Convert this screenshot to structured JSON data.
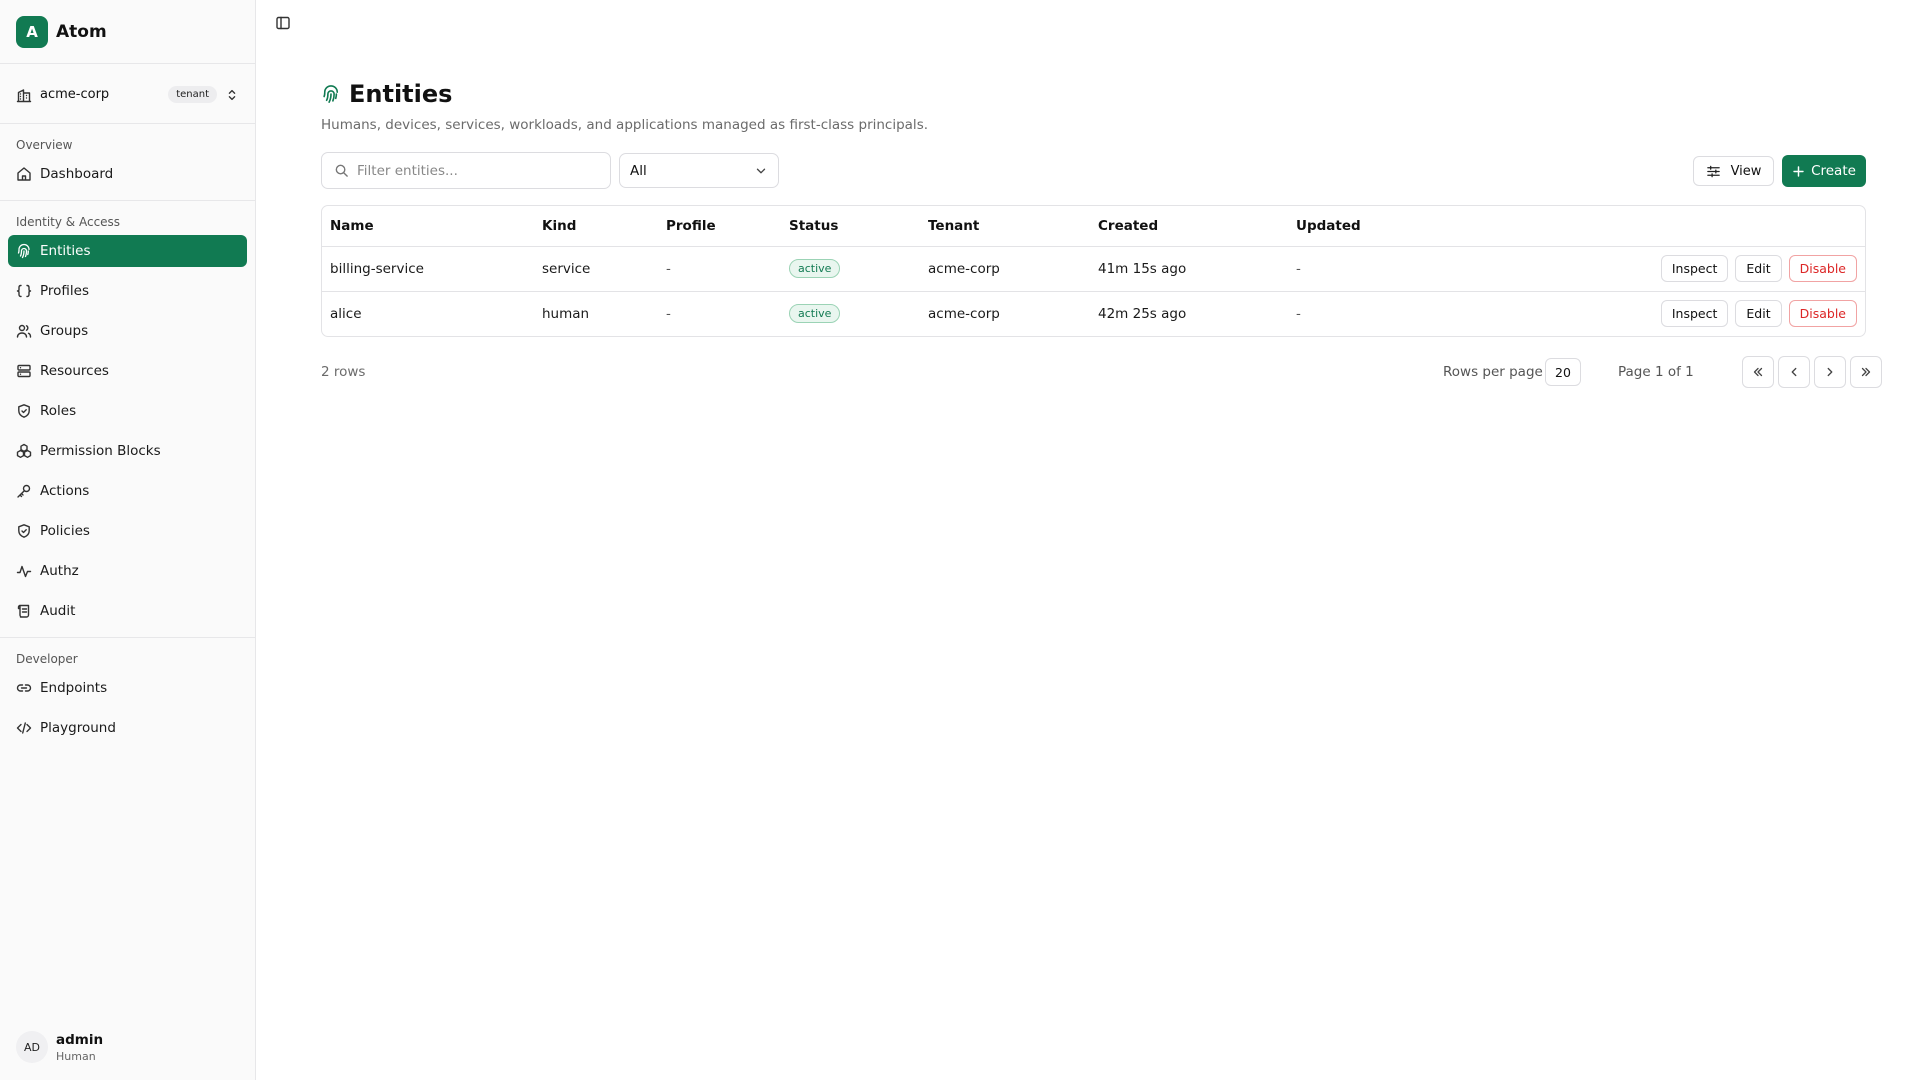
{
  "brand": {
    "logo_letter": "A",
    "name": "Atom",
    "accent": "#117a52"
  },
  "tenant": {
    "name": "acme-corp",
    "badge": "tenant"
  },
  "sidebar": {
    "sections": [
      {
        "title": "Overview",
        "items": [
          {
            "label": "Dashboard",
            "icon": "home-icon"
          }
        ]
      },
      {
        "title": "Identity & Access",
        "items": [
          {
            "label": "Entities",
            "icon": "fingerprint-icon",
            "active": true
          },
          {
            "label": "Profiles",
            "icon": "braces-icon"
          },
          {
            "label": "Groups",
            "icon": "users-icon"
          },
          {
            "label": "Resources",
            "icon": "server-icon"
          },
          {
            "label": "Roles",
            "icon": "shield-icon"
          },
          {
            "label": "Permission Blocks",
            "icon": "blocks-icon"
          },
          {
            "label": "Actions",
            "icon": "key-icon"
          },
          {
            "label": "Policies",
            "icon": "shield-icon"
          },
          {
            "label": "Authz",
            "icon": "activity-icon"
          },
          {
            "label": "Audit",
            "icon": "scroll-icon"
          }
        ]
      },
      {
        "title": "Developer",
        "items": [
          {
            "label": "Endpoints",
            "icon": "link-icon"
          },
          {
            "label": "Playground",
            "icon": "code-icon"
          }
        ]
      }
    ]
  },
  "user": {
    "initials": "AD",
    "name": "admin",
    "role": "Human"
  },
  "page": {
    "title": "Entities",
    "subtitle": "Humans, devices, services, workloads, and applications managed as first-class principals."
  },
  "toolbar": {
    "search_placeholder": "Filter entities...",
    "filter_value": "All",
    "view_label": "View",
    "create_label": "Create"
  },
  "table": {
    "columns": [
      "Name",
      "Kind",
      "Profile",
      "Status",
      "Tenant",
      "Created",
      "Updated"
    ],
    "rows": [
      {
        "name": "billing-service",
        "kind": "service",
        "profile": "-",
        "status": "active",
        "tenant": "acme-corp",
        "created": "41m 15s ago",
        "updated": "-"
      },
      {
        "name": "alice",
        "kind": "human",
        "profile": "-",
        "status": "active",
        "tenant": "acme-corp",
        "created": "42m 25s ago",
        "updated": "-"
      }
    ],
    "row_actions": {
      "inspect": "Inspect",
      "edit": "Edit",
      "disable": "Disable"
    }
  },
  "footer": {
    "rows_count": "2 rows",
    "rows_per_page_label": "Rows per page",
    "rows_per_page": "20",
    "page_label": "Page 1 of 1"
  }
}
